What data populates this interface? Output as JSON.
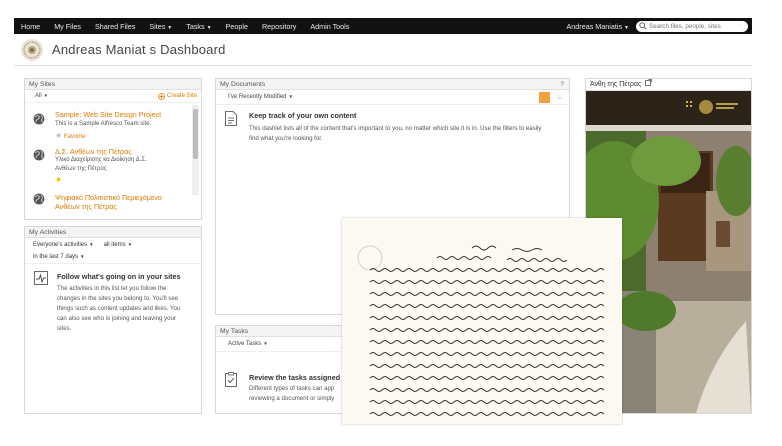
{
  "nav": {
    "items": [
      "Home",
      "My Files",
      "Shared Files",
      "Sites",
      "Tasks",
      "People",
      "Repository",
      "Admin Tools"
    ],
    "user": "Andreas Maniatis",
    "search_placeholder": "Search files, people, sites"
  },
  "header": {
    "title": "Andreas Maniat s Dashboard"
  },
  "my_sites": {
    "title": "My Sites",
    "filter": "All",
    "create_link": "Create Site",
    "sites": [
      {
        "name": "Sample: Web Site Design Project",
        "desc": "This is a Sample Alfresco Team site.",
        "fav": "Favorite"
      },
      {
        "name": "Δ.Σ. Ανθέων της Πέτρας",
        "desc": "Υλικό Διαχείρισης κα Διοίκηση Δ.Σ.",
        "desc2": "Ανθέων της Πέτρας"
      },
      {
        "name": "Ψηφιακό Πολιτιστικό Περιεχόμενο",
        "name2": "Ανθέων της Πέτρας"
      }
    ]
  },
  "my_documents": {
    "title": "My Documents",
    "help": "?",
    "filter": "I've Recently Modified",
    "empty_title": "Keep track of your own content",
    "empty_body_1": "This dashlet lists all of the content that's important to you, no matter which site it is in. Use the filters to easily",
    "empty_body_2": "find what you're looking for."
  },
  "my_activities": {
    "title": "My Activities",
    "filter1": "Everyone's activities",
    "filter2": "all items",
    "filter3": "in the last 7 days",
    "empty_title": "Follow what's going on in your sites",
    "body": [
      "The activities in this list let you follow the",
      "changes in the sites you belong to. You'll see",
      "things such as content updates and likes. You",
      "can also see who is joining and leaving your",
      "sites."
    ]
  },
  "my_tasks": {
    "title": "My Tasks",
    "filter": "Active Tasks",
    "empty_title": "Review the tasks assigned t",
    "body": [
      "Different types of tasks can app",
      "reviewing a document or simply"
    ]
  },
  "photo_panel": {
    "title": "Άνθη της Πέτρας"
  },
  "colors": {
    "accent": "#e07b00",
    "nav_bg": "#111111"
  }
}
